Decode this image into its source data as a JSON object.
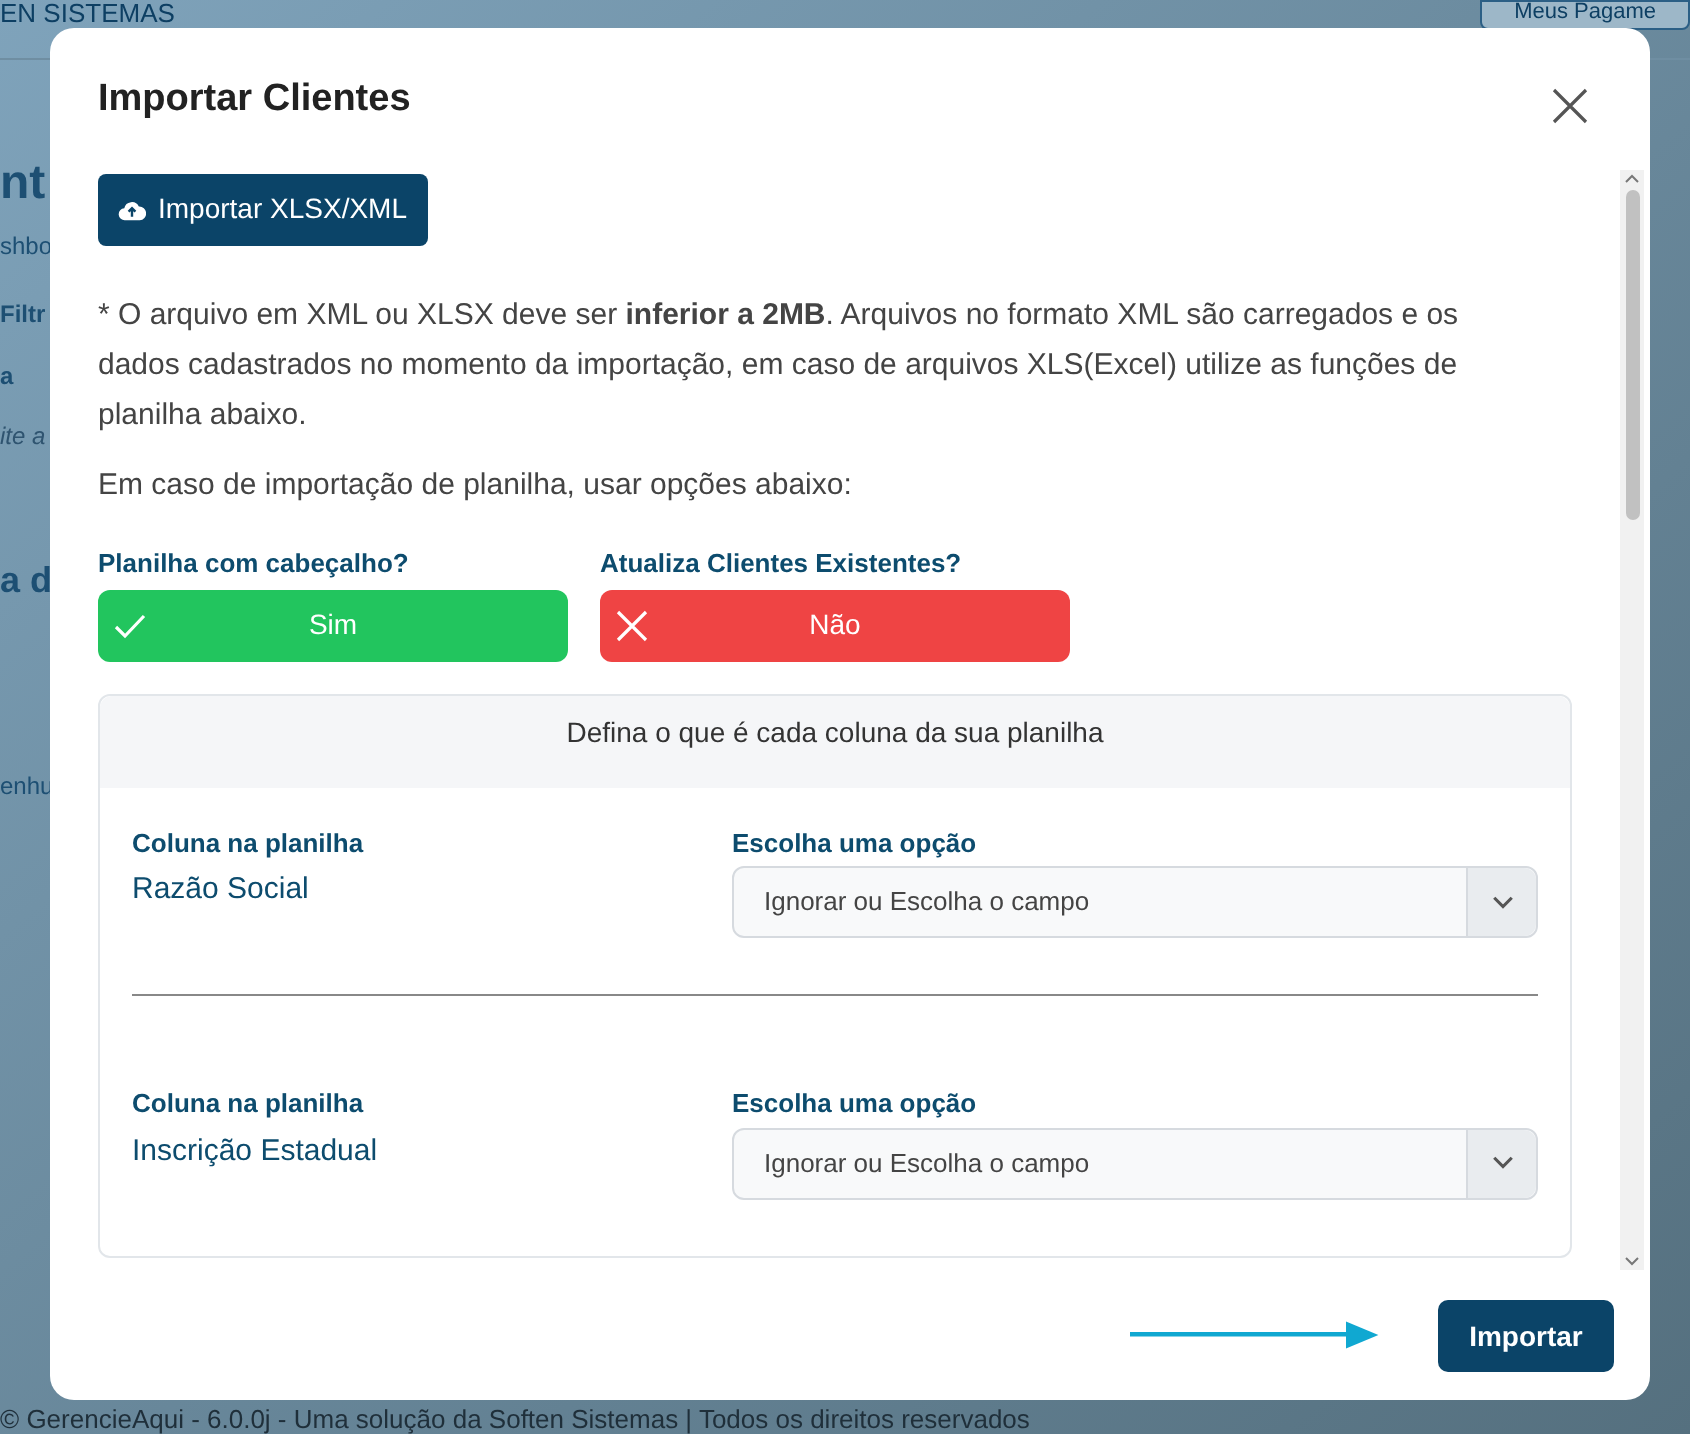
{
  "background": {
    "brand": "EN SISTEMAS",
    "top_button": "Meus Pagame",
    "fragments": [
      "nt",
      "shbo",
      "Filtr",
      "a",
      "ite a",
      "a d",
      "enhu"
    ],
    "footer": "© GerencieAqui - 6.0.0j - Uma solução da Soften Sistemas | Todos os direitos reservados"
  },
  "modal": {
    "title": "Importar Clientes",
    "upload_button": "Importar XLSX/XML",
    "notice": "* O arquivo em XML ou XLSX deve ser **inferior a 2MB**. Arquivos no formato XML são carregados e os dados cadastrados no momento da importação, em caso de arquivos XLS(Excel) utilize as funções de planilha abaixo.",
    "options_intro": "Em caso de importação de planilha, usar opções abaixo:",
    "toggles": [
      {
        "label": "Planilha com cabeçalho?",
        "value": "Sim",
        "on": true
      },
      {
        "label": "Atualiza Clientes Existentes?",
        "value": "Não",
        "on": false
      }
    ],
    "mapping": {
      "title": "Defina o que é cada coluna da sua planilha",
      "rows": [
        {
          "column_label": "Coluna na planilha",
          "column_name": "Razão Social",
          "select_label": "Escolha uma opção",
          "select_value": "Ignorar ou Escolha o campo"
        },
        {
          "column_label": "Coluna na planilha",
          "column_name": "Inscrição Estadual",
          "select_label": "Escolha uma opção",
          "select_value": "Ignorar ou Escolha o campo"
        }
      ]
    },
    "submit_button": "Importar"
  }
}
